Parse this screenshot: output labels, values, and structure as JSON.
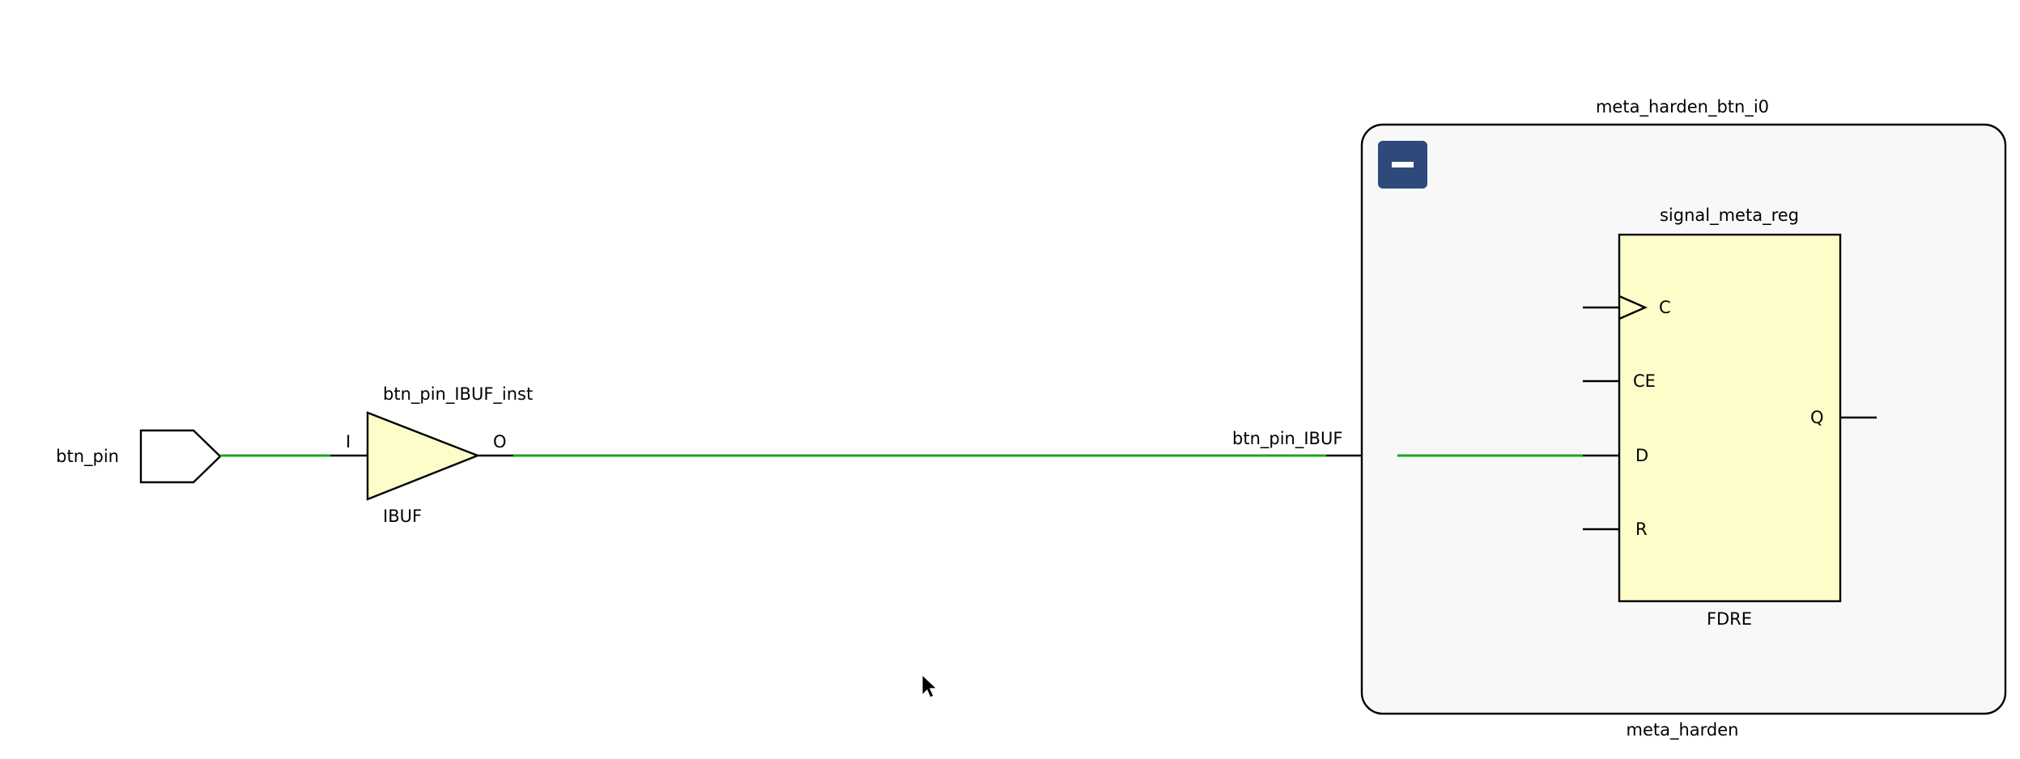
{
  "diagram": {
    "top_port": {
      "name": "btn_pin",
      "direction": "input"
    },
    "ibuf": {
      "instance": "btn_pin_IBUF_inst",
      "type": "IBUF",
      "pin_in": "I",
      "pin_out": "O"
    },
    "net": {
      "name": "btn_pin_IBUF",
      "color": "#1aa81a"
    },
    "hier_block": {
      "instance": "meta_harden_btn_i0",
      "module": "meta_harden",
      "collapse_button": "−",
      "collapse_button_color": "#2e4a7d"
    },
    "flop": {
      "instance": "signal_meta_reg",
      "type": "FDRE",
      "pins": {
        "clock": "C",
        "enable": "CE",
        "data": "D",
        "reset": "R",
        "output": "Q"
      }
    },
    "colors": {
      "cell_fill": "#fdfdca",
      "hier_fill": "#f8f8f8"
    },
    "cursor_icon": "mouse-pointer-icon"
  }
}
